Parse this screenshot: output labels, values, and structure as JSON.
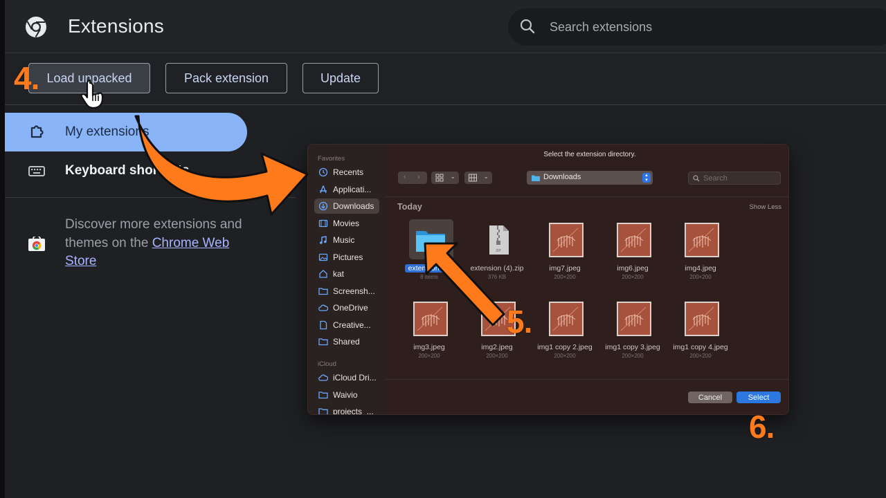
{
  "header": {
    "title": "Extensions",
    "search_placeholder": "Search extensions",
    "logo_icon": "chrome-logo-icon",
    "search_icon": "search-icon"
  },
  "toolbar": {
    "load_unpacked": "Load unpacked",
    "pack_extension": "Pack extension",
    "update": "Update"
  },
  "sidebar": {
    "items": [
      {
        "label": "My extensions",
        "icon": "puzzle-icon",
        "active": true
      },
      {
        "label": "Keyboard shortcuts",
        "icon": "keyboard-icon",
        "active": false
      }
    ],
    "store_text": "Discover more extensions and themes on the ",
    "store_link": "Chrome Web Store"
  },
  "dialog": {
    "title": "Select the extension directory.",
    "favorites_label": "Favorites",
    "favorites": [
      "Recents",
      "Applicati...",
      "Downloads",
      "Movies",
      "Music",
      "Pictures",
      "kat",
      "Screensh...",
      "OneDrive",
      "Creative...",
      "Shared"
    ],
    "icloud_label": "iCloud",
    "icloud": [
      "iCloud Dri...",
      "Waivio",
      "projects_..."
    ],
    "location": "Downloads",
    "search_placeholder": "Search",
    "section": "Today",
    "show_less": "Show Less",
    "files": [
      {
        "name": "extension (4)",
        "meta": "8 items",
        "kind": "folder"
      },
      {
        "name": "extension (4).zip",
        "meta": "376 KB",
        "kind": "zip"
      },
      {
        "name": "img7.jpeg",
        "meta": "200×200",
        "kind": "image"
      },
      {
        "name": "img6.jpeg",
        "meta": "200×200",
        "kind": "image"
      },
      {
        "name": "img4.jpeg",
        "meta": "200×200",
        "kind": "image"
      },
      {
        "name": "img3.jpeg",
        "meta": "200×200",
        "kind": "image"
      },
      {
        "name": "img2.jpeg",
        "meta": "200×200",
        "kind": "image"
      },
      {
        "name": "img1 copy 2.jpeg",
        "meta": "200×200",
        "kind": "image"
      },
      {
        "name": "img1 copy 3.jpeg",
        "meta": "200×200",
        "kind": "image"
      },
      {
        "name": "img1 copy 4.jpeg",
        "meta": "200×200",
        "kind": "image"
      }
    ],
    "cancel": "Cancel",
    "select": "Select"
  },
  "annotations": {
    "step4": "4.",
    "step5": "5.",
    "step6": "6."
  },
  "colors": {
    "accent": "#8ab4f8",
    "annotation": "#ff7a1a",
    "dialog_select": "#2d78e0"
  }
}
